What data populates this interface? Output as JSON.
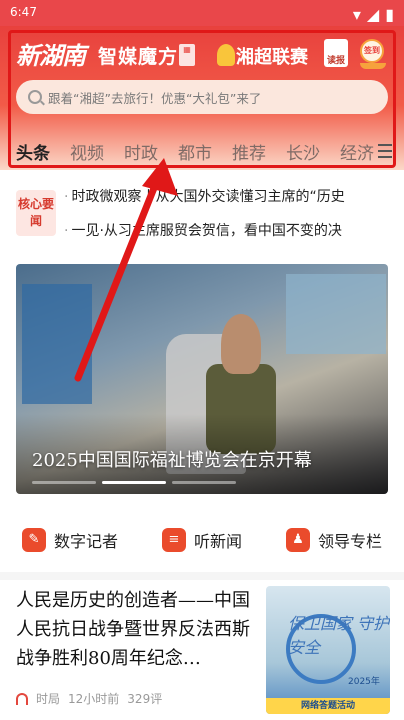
{
  "status_bar": {
    "time": "6:47"
  },
  "header": {
    "logo_text": "新湖南",
    "promo_title": "智媒魔方",
    "league_text": "湘超联赛",
    "dubao_label": "读报",
    "signin_label": "签到"
  },
  "search": {
    "placeholder": "跟着“湘超”去旅行！优惠“大礼包”来了"
  },
  "tabs": [
    "头条",
    "视频",
    "时政",
    "都市",
    "推荐",
    "长沙",
    "经济"
  ],
  "ticker": {
    "badge": "核心要闻",
    "lines": [
      "时政微观察丨从大国外交读懂习主席的“历史",
      "一见·从习主席服贸会贺信，看中国不变的决"
    ]
  },
  "hero": {
    "caption": "2025中国国际福祉博览会在京开幕"
  },
  "quick_links": [
    {
      "label": "数字记者",
      "icon": "microphone-icon"
    },
    {
      "label": "听新闻",
      "icon": "radio-icon"
    },
    {
      "label": "领导专栏",
      "icon": "leader-icon"
    }
  ],
  "article": {
    "title": "人民是历史的创造者——中国人民抗日战争暨世界反法西斯战争胜利80周年纪念…",
    "source": "时局",
    "time": "12小时前",
    "comments": "329评",
    "thumb_title": "保卫国家 守护安全",
    "thumb_year": "2025年",
    "thumb_band": "网络答题活动"
  },
  "colors": {
    "brand_red": "#e8413d",
    "accent_orange": "#ea4b2c",
    "annotation_red": "#e01818"
  }
}
